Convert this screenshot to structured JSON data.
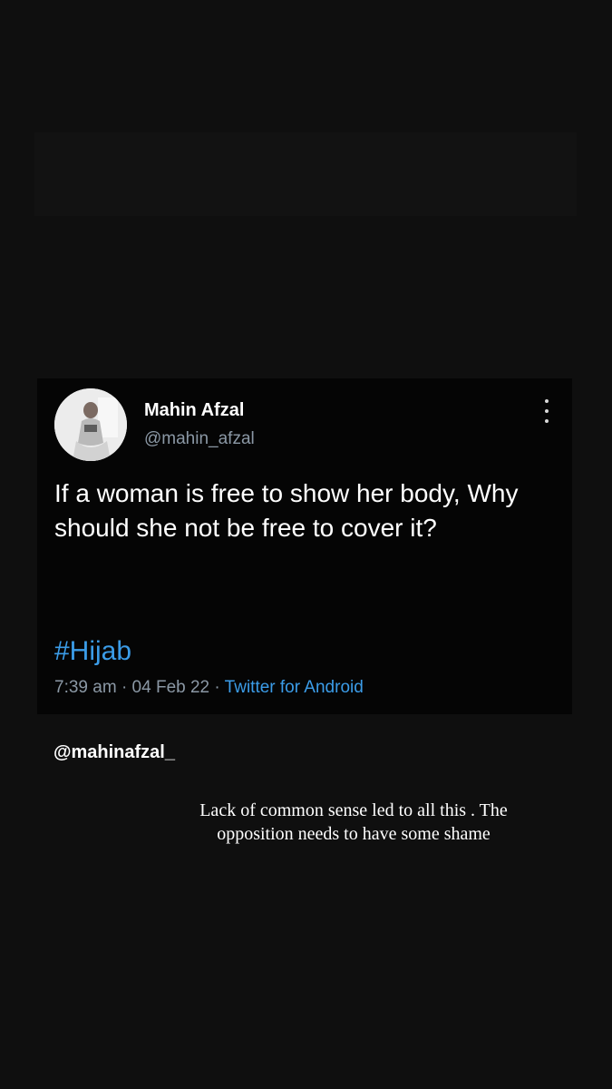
{
  "tweet": {
    "display_name": "Mahin Afzal",
    "handle": "@mahin_afzal",
    "text": "If a woman is free to show her body, Why should she not be free to cover it?",
    "hashtag": "#Hijab",
    "time": "7:39 am",
    "separator": "·",
    "date": "04 Feb 22",
    "source": "Twitter for Android",
    "avatar_icon": "profile-photo",
    "menu_icon": "more-vertical-icon"
  },
  "story": {
    "mention": "@mahinafzal_",
    "caption": "Lack of common sense led to all this . The opposition needs to have some shame"
  },
  "colors": {
    "background": "#0f0f0f",
    "card": "#050505",
    "link": "#3b9ce8",
    "muted": "#8b98a5"
  }
}
